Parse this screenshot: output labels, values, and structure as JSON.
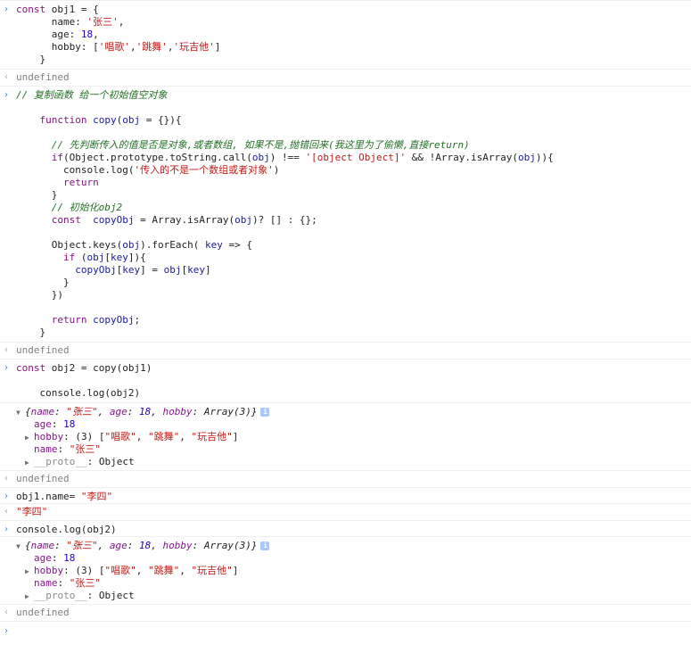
{
  "entries": [
    {
      "type": "input",
      "lines": [
        [
          "const obj1 = {"
        ],
        [
          "      name: ",
          "'张三'",
          ","
        ],
        [
          "      age: ",
          "18",
          ","
        ],
        [
          "      hobby: [",
          "'唱歌'",
          ",",
          "'跳舞'",
          ",",
          "'玩吉他'",
          "]"
        ],
        [
          "    }"
        ]
      ]
    },
    {
      "type": "output",
      "text": "undefined"
    },
    {
      "type": "input",
      "code": [
        "// 复制函数 给一个初始值空对象",
        "",
        "    function copy(obj = {}){",
        "",
        "      // 先判断传入的值是否是对象,或者数组, 如果不是,抛错回来(我这里为了偷懒,直接return)",
        "      if(Object.prototype.toString.call(obj) !== '[object Object]' && !Array.isArray(obj)){",
        "        console.log('传入的不是一个数组或者对象')",
        "        return",
        "      }",
        "      // 初始化obj2",
        "      const  copyObj = Array.isArray(obj)? [] : {};",
        "",
        "      Object.keys(obj).forEach( key => {",
        "        if (obj[key]){",
        "          copyObj[key] = obj[key]",
        "        }",
        "      })",
        "",
        "      return copyObj;",
        "    }"
      ]
    },
    {
      "type": "output",
      "text": "undefined"
    },
    {
      "type": "input",
      "code": [
        "const obj2 = copy(obj1)",
        "",
        "    console.log(obj2)"
      ]
    },
    {
      "type": "object",
      "summary": {
        "open": "{",
        "name_key": "name",
        "name_val": "\"张三\"",
        "age_key": "age",
        "age_val": "18",
        "hobby_key": "hobby",
        "hobby_val": "Array(3)",
        "close": "}"
      },
      "props": {
        "age_key": "age",
        "age_val": "18",
        "hobby_key": "hobby",
        "hobby_preview": "(3) [",
        "hobby_items": [
          "\"唱歌\"",
          "\"跳舞\"",
          "\"玩吉他\""
        ],
        "hobby_close": "]",
        "name_key": "name",
        "name_val": "\"张三\"",
        "proto_key": "__proto__",
        "proto_val": "Object"
      }
    },
    {
      "type": "output",
      "text": "undefined"
    },
    {
      "type": "input",
      "code": [
        "obj1.name= \"李四\""
      ]
    },
    {
      "type": "result",
      "text": "\"李四\""
    },
    {
      "type": "input",
      "code": [
        "console.log(obj2)"
      ]
    },
    {
      "type": "object",
      "summary": {
        "open": "{",
        "name_key": "name",
        "name_val": "\"张三\"",
        "age_key": "age",
        "age_val": "18",
        "hobby_key": "hobby",
        "hobby_val": "Array(3)",
        "close": "}"
      },
      "props": {
        "age_key": "age",
        "age_val": "18",
        "hobby_key": "hobby",
        "hobby_preview": "(3) [",
        "hobby_items": [
          "\"唱歌\"",
          "\"跳舞\"",
          "\"玩吉他\""
        ],
        "hobby_close": "]",
        "name_key": "name",
        "name_val": "\"张三\"",
        "proto_key": "__proto__",
        "proto_val": "Object"
      }
    },
    {
      "type": "output",
      "text": "undefined"
    }
  ],
  "prompt_glyph": "›",
  "output_glyph": "‹",
  "info_glyph": "i"
}
